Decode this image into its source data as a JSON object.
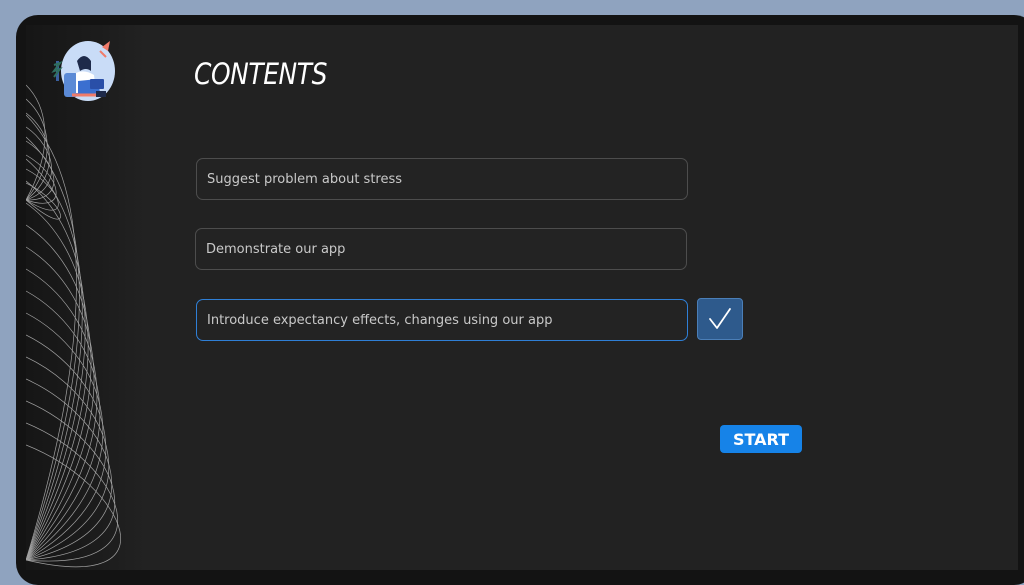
{
  "page": {
    "title": "CONTENTS"
  },
  "items": [
    {
      "label": "Suggest problem about stress",
      "active": false
    },
    {
      "label": "Demonstrate our app",
      "active": false
    },
    {
      "label": "Introduce expectancy effects, changes using our app",
      "active": true
    }
  ],
  "actions": {
    "check_icon": "checkmark-icon",
    "start_label": "START"
  },
  "illustration": {
    "icon": "person-relaxing-illustration"
  },
  "colors": {
    "background": "#222222",
    "frame": "#131313",
    "desktop": "#8fa3bf",
    "accent": "#1683e8",
    "active_border": "#2f7fd6",
    "check_button": "#2e5a8c",
    "field_border": "#4d4d4d",
    "field_text": "#c9c9c9"
  }
}
